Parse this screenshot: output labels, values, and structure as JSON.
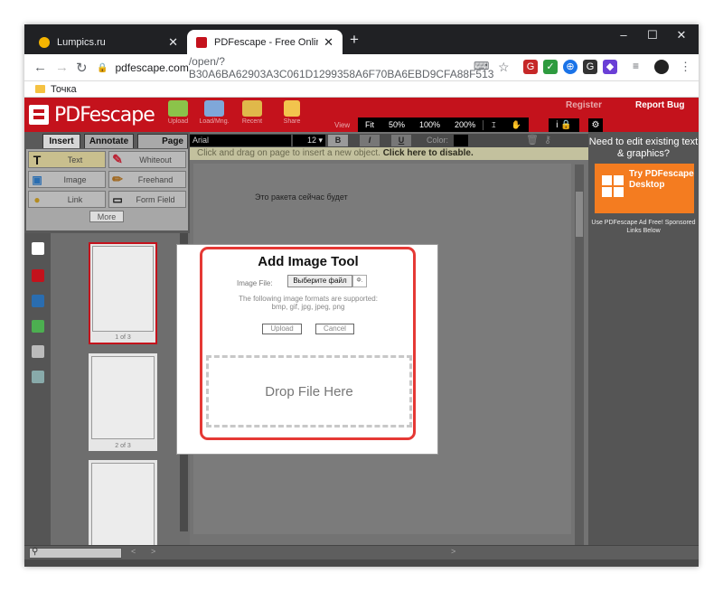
{
  "browser": {
    "tabs": [
      {
        "label": "Lumpics.ru",
        "favicon_color": "#f4b400"
      },
      {
        "label": "PDFescape - Free Online PDF Edi",
        "favicon_color": "#c4121c"
      }
    ],
    "new_tab": "+",
    "window_controls": {
      "minimize": "–",
      "maximize": "☐",
      "close": "✕"
    },
    "url_host": "pdfescape.com",
    "url_path": "/open/?B30A6BA62903A3C061D1299358A6F70BA6EBD9CFA88F513",
    "bookmark": "Точка"
  },
  "app": {
    "logo": "PDFescape",
    "toolbar": [
      "Upload",
      "Load/Mng.",
      "Recent",
      "Share"
    ],
    "view_label": "View",
    "zoom": [
      "Fit",
      "50%",
      "100%",
      "200%"
    ],
    "register": "Register",
    "report_bug": "Report Bug"
  },
  "left": {
    "tabs": [
      "Insert",
      "Annotate",
      "Page"
    ],
    "tools": [
      {
        "label": "Text",
        "icon": "text-tool-icon"
      },
      {
        "label": "Whiteout",
        "icon": "whiteout-icon"
      },
      {
        "label": "Image",
        "icon": "image-icon"
      },
      {
        "label": "Freehand",
        "icon": "pencil-icon"
      },
      {
        "label": "Link",
        "icon": "link-icon"
      },
      {
        "label": "Form Field",
        "icon": "form-field-icon"
      }
    ],
    "more": "More",
    "thumbs": [
      "1 of 3",
      "2 of 3"
    ]
  },
  "format": {
    "font": "Arial",
    "size": "12 ▾",
    "bold": "B",
    "italic": "I",
    "underline": "U",
    "color_label": "Color:"
  },
  "hint": {
    "text": "Click and drag on page to insert a new object.",
    "link": "Click here to disable."
  },
  "page_text": "Это ракета сейчас будет",
  "modal": {
    "title": "Add Image Tool",
    "file_label": "Image File:",
    "choose_button": "Выберите файл",
    "file_name": "Ф.",
    "formats_line1": "The following image formats are supported:",
    "formats_line2": "bmp, gif, jpg, jpeg, png",
    "upload": "Upload",
    "cancel": "Cancel",
    "drop": "Drop File Here"
  },
  "right": {
    "need": "Need to edit existing text & graphics?",
    "try": "Try PDFescape Desktop",
    "adfree": "Use PDFescape Ad Free! Sponsored Links Below"
  },
  "status": {
    "prev": "<",
    "next": ">"
  }
}
